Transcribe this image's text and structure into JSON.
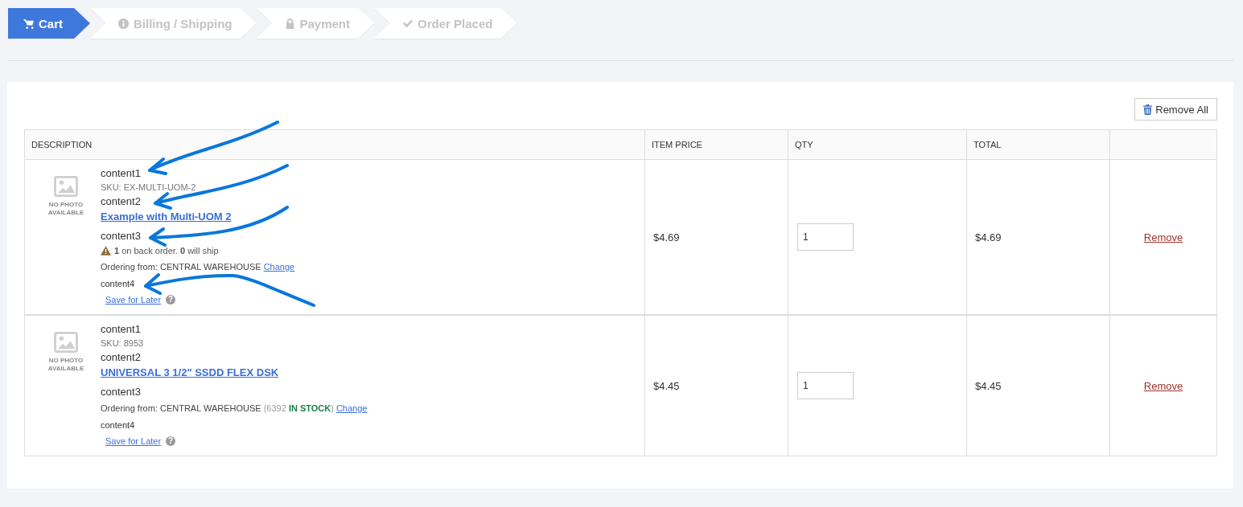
{
  "steps": [
    {
      "label": "Cart",
      "selected": true
    },
    {
      "label": "Billing / Shipping",
      "selected": false
    },
    {
      "label": "Payment",
      "selected": false
    },
    {
      "label": "Order Placed",
      "selected": false
    }
  ],
  "remove_all": "Remove All",
  "table": {
    "columns": [
      "DESCRIPTION",
      "ITEM PRICE",
      "QTY",
      "TOTAL"
    ],
    "rows": [
      {
        "photo_text": "NO PHOTO AVAILABLE",
        "content1": "content1",
        "sku": "SKU: EX-MULTI-UOM-2",
        "content2": "content2",
        "name": "Example with Multi-UOM 2",
        "content3": "content3",
        "backorder": "**1** on back order. **0** will ship",
        "ordering_from": "Ordering from: CENTRAL WAREHOUSE",
        "change": "Change",
        "content4": "content4",
        "save_for_later": "Save for Later",
        "help": "?",
        "price": "$4.69",
        "qty": "1",
        "total": "$4.69",
        "remove": "Remove"
      },
      {
        "photo_text": "NO PHOTO AVAILABLE",
        "content1": "content1",
        "sku": "SKU: 8953",
        "content2": "content2",
        "name": "UNIVERSAL 3 1/2\" SSDD FLEX DSK",
        "content3": "content3",
        "ordering_from": "Ordering from: CENTRAL WAREHOUSE",
        "stock": "(6392 **IN STOCK**)",
        "change": "Change",
        "content4": "content4",
        "save_for_later": "Save for Later",
        "help": "?",
        "price": "$4.45",
        "qty": "1",
        "total": "$4.45",
        "remove": "Remove"
      }
    ]
  }
}
